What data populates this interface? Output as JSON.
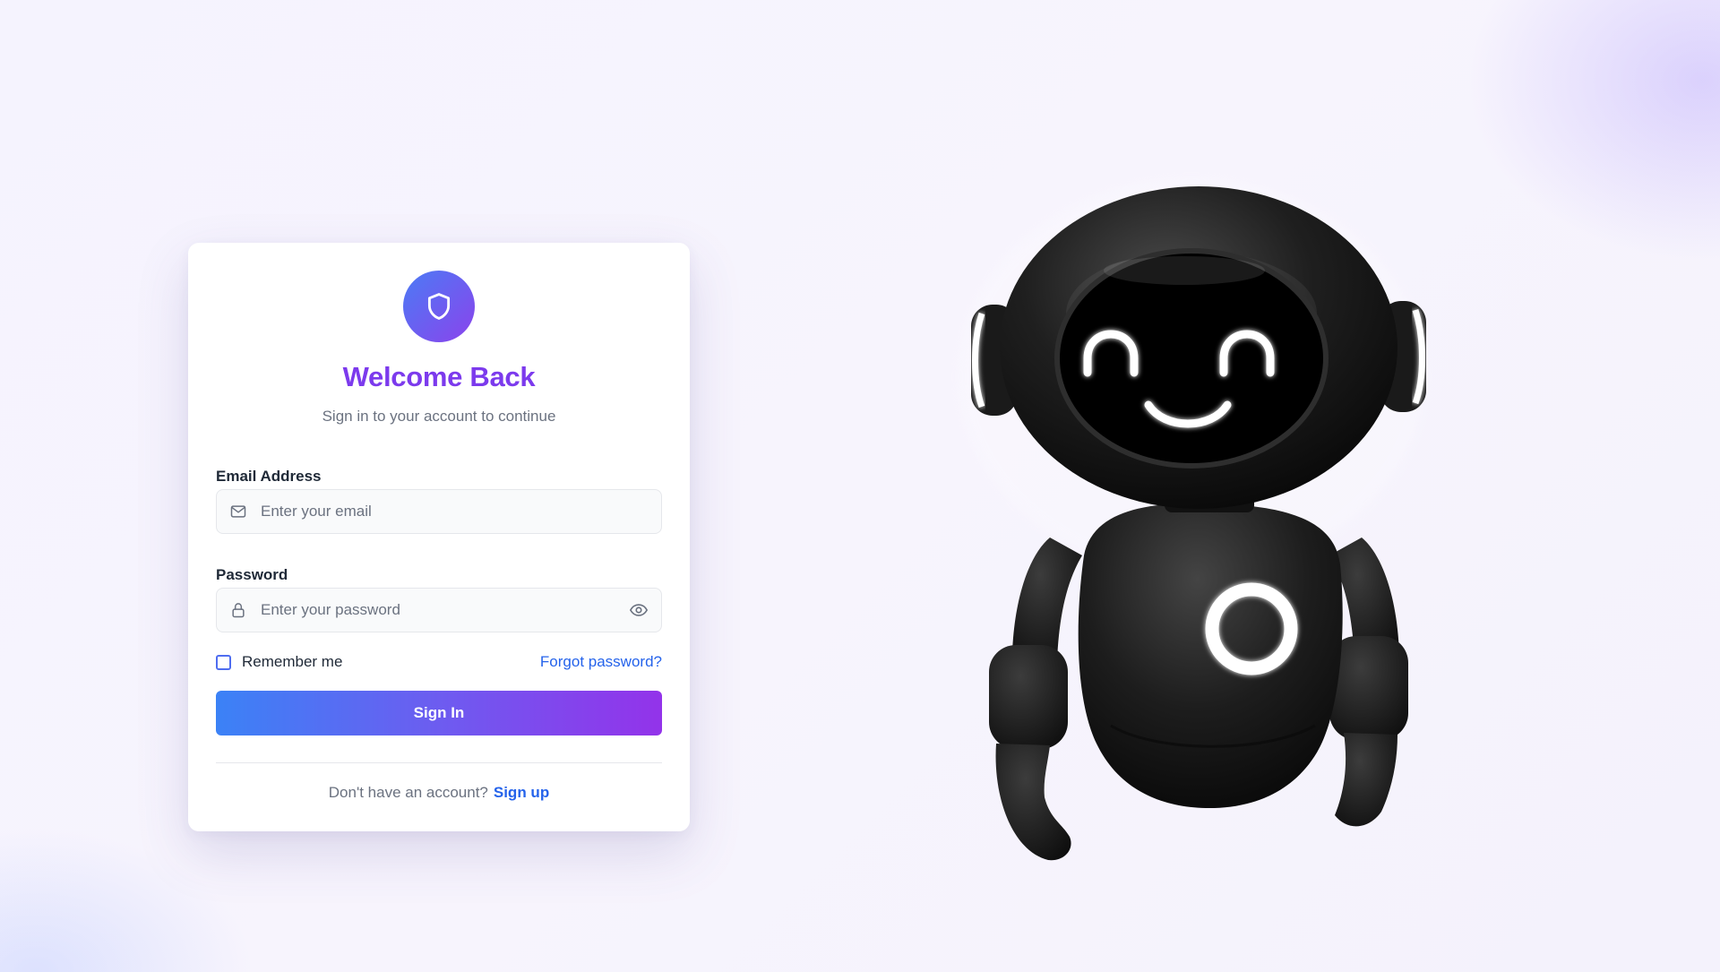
{
  "login": {
    "title": "Welcome Back",
    "subtitle": "Sign in to your account to continue",
    "email": {
      "label": "Email Address",
      "placeholder": "Enter your email",
      "value": ""
    },
    "password": {
      "label": "Password",
      "placeholder": "Enter your password",
      "value": ""
    },
    "remember_label": "Remember me",
    "forgot_label": "Forgot password?",
    "signin_label": "Sign In",
    "signup_prompt": "Don't have an account?",
    "signup_label": "Sign up"
  },
  "icons": {
    "logo": "shield-icon",
    "email": "mail-icon",
    "password": "lock-icon",
    "toggle": "eye-icon"
  },
  "colors": {
    "accent": "#7c3aed",
    "link": "#2563eb",
    "button_start": "#3b82f6",
    "button_end": "#9333ea"
  }
}
